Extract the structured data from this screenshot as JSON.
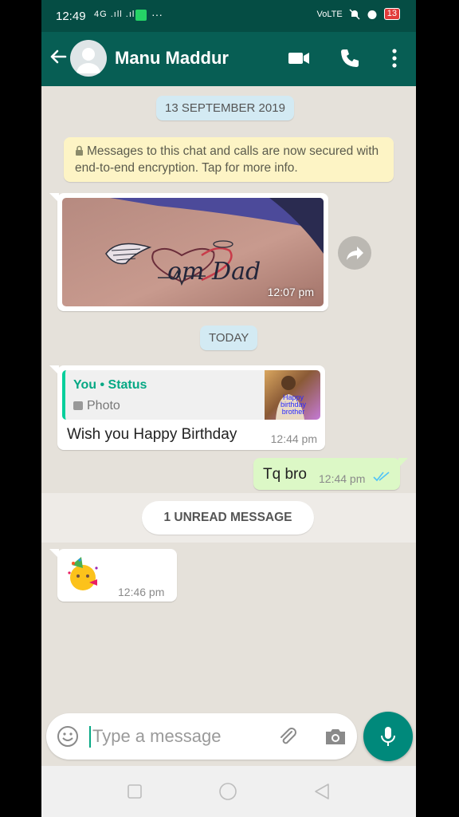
{
  "status_bar": {
    "time": "12:49",
    "network": "4G .ıll .ıll",
    "more": "···",
    "battery": "13"
  },
  "header": {
    "contact_name": "Manu Maddur"
  },
  "chat": {
    "date_pill": "13 SEPTEMBER 2019",
    "encryption_notice": "Messages to this chat and calls are now secured with end-to-end encryption. Tap for more info.",
    "image_message": {
      "time": "12:07 pm",
      "caption_in_image": "om Dad"
    },
    "today_pill": "TODAY",
    "reply_message": {
      "quote_author": "You • Status",
      "quote_type": "Photo",
      "thumbnail_text": "Happy birthday brother",
      "text": "Wish you Happy Birthday",
      "time": "12:44 pm"
    },
    "outgoing_message": {
      "text": "Tq bro",
      "time": "12:44 pm",
      "status": "read"
    },
    "unread_banner": "1 UNREAD MESSAGE",
    "emoji_message": {
      "emoji": "partying-face",
      "time": "12:46 pm"
    }
  },
  "composer": {
    "placeholder": "Type a message"
  },
  "colors": {
    "header": "#075e54",
    "accent": "#00897b",
    "outgoing_bubble": "#dcf8c6",
    "quote_bar": "#06cf9c"
  }
}
